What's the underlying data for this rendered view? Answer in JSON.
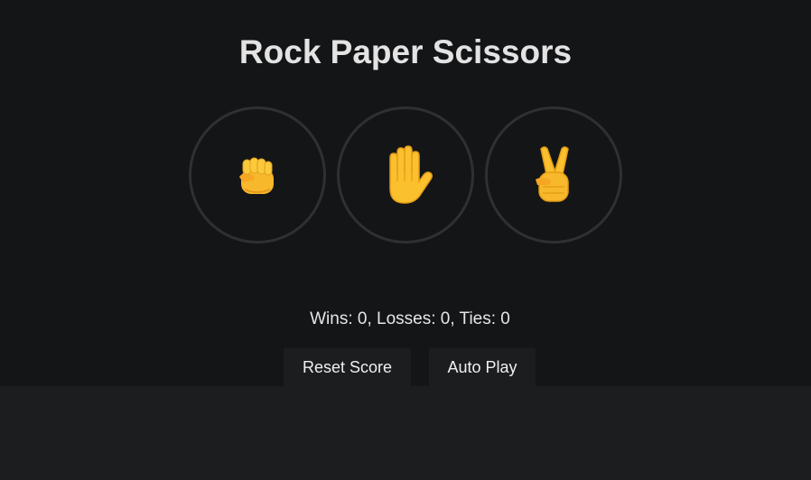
{
  "title": "Rock Paper Scissors",
  "moves": [
    {
      "name": "rock",
      "icon": "raised-fist-icon"
    },
    {
      "name": "paper",
      "icon": "raised-hand-icon"
    },
    {
      "name": "scissors",
      "icon": "victory-hand-icon"
    }
  ],
  "score": {
    "text": "Wins: 0, Losses: 0, Ties: 0",
    "wins": 0,
    "losses": 0,
    "ties": 0
  },
  "controls": {
    "reset_label": "Reset Score",
    "autoplay_label": "Auto Play"
  },
  "colors": {
    "background": "#141517",
    "page_bottom": "#1c1d1f",
    "circle_border": "#2f3033",
    "emoji_yellow": "#fbbf24",
    "emoji_shadow": "#e59e1b"
  }
}
